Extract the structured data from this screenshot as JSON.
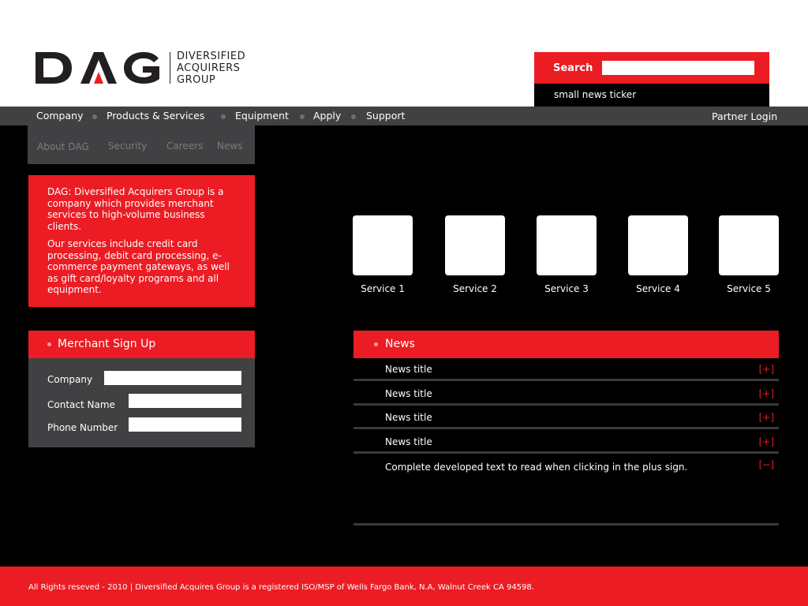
{
  "brand": {
    "logo_text": "DAG",
    "logo_words": [
      "DIVERSIFIED",
      "ACQUIRERS",
      "GROUP"
    ]
  },
  "search": {
    "label": "Search",
    "placeholder": ""
  },
  "ticker": {
    "text": "small news ticker"
  },
  "nav": {
    "items": [
      "Company",
      "Products & Services",
      "Equipment",
      "Apply",
      "Support"
    ],
    "partner_login": "Partner Login"
  },
  "subnav": {
    "items": [
      "About DAG",
      "Security",
      "Careers",
      "News"
    ]
  },
  "intro": {
    "paragraph1": "DAG: Diversified Acquirers Group is a company which provides merchant services to high-volume business clients.",
    "paragraph2": "Our services include credit card processing, debit card processing, e-commerce payment gateways, as well as gift card/loyalty programs and all equipment."
  },
  "signup": {
    "title": "Merchant Sign Up",
    "fields": [
      "Company",
      "Contact Name",
      "Phone Number"
    ]
  },
  "services": [
    "Service 1",
    "Service 2",
    "Service 3",
    "Service 4",
    "Service 5"
  ],
  "news": {
    "title": "News",
    "items": [
      {
        "title": "News title",
        "toggle": "[+]"
      },
      {
        "title": "News title",
        "toggle": "[+]"
      },
      {
        "title": "News title",
        "toggle": "[+]"
      },
      {
        "title": "News title",
        "toggle": "[+]"
      }
    ],
    "expanded": {
      "text": "Complete developed text to read when clicking in the plus sign.",
      "toggle": "[−]"
    }
  },
  "footer": {
    "text": "All Rights reseved - 2010 | Diversified Acquires Group is a registered ISO/MSP of Wells Fargo Bank, N.A, Walnut Creek CA 94598."
  },
  "colors": {
    "accent": "#ec1c24",
    "dark_gray": "#414042",
    "logo_dark": "#231f20"
  }
}
